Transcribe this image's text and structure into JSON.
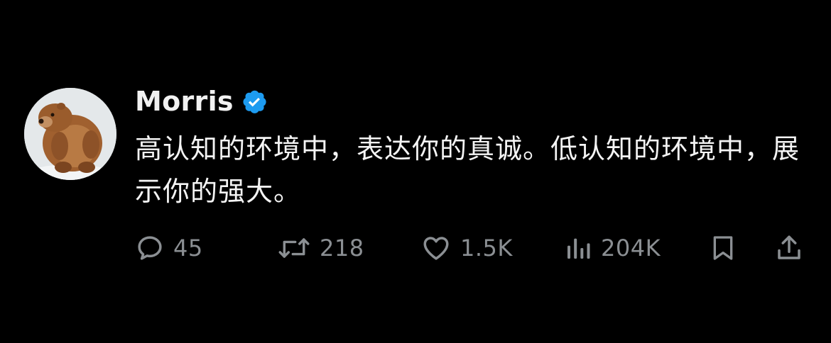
{
  "author": {
    "name": "Morris",
    "verified_icon": "verified-badge-icon",
    "avatar": "bear-avatar"
  },
  "post": {
    "text": "高认知的环境中，表达你的真诚。低认知的环境中，展示你的强大。"
  },
  "actions": {
    "reply": {
      "icon": "reply-icon",
      "count": "45"
    },
    "repost": {
      "icon": "repost-icon",
      "count": "218"
    },
    "like": {
      "icon": "heart-icon",
      "count": "1.5K"
    },
    "views": {
      "icon": "views-icon",
      "count": "204K"
    },
    "bookmark": {
      "icon": "bookmark-icon"
    },
    "share": {
      "icon": "share-icon"
    }
  },
  "colors": {
    "background": "#000000",
    "text": "#f4f4f4",
    "muted": "#8b8f93",
    "verified": "#1d9bf0"
  }
}
